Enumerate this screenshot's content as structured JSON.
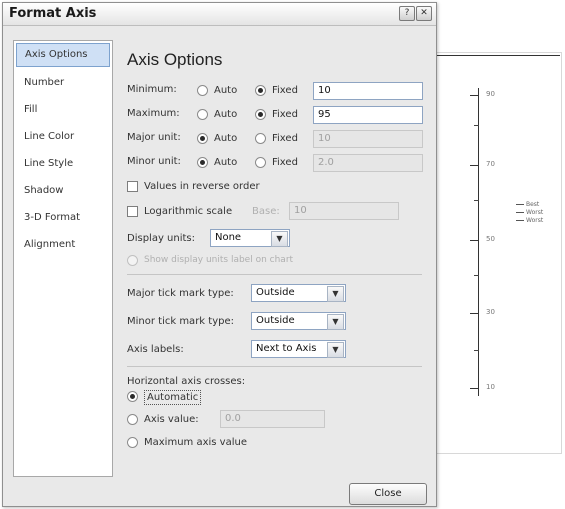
{
  "window": {
    "title": "Format Axis",
    "help_glyph": "?",
    "close_glyph": "✕"
  },
  "nav": {
    "items": [
      "Axis Options",
      "Number",
      "Fill",
      "Line Color",
      "Line Style",
      "Shadow",
      "3-D Format",
      "Alignment"
    ]
  },
  "panel": {
    "heading": "Axis Options",
    "minimum": {
      "label": "Minimum:",
      "auto": "Auto",
      "fixed": "Fixed",
      "value": "10",
      "selected": "fixed"
    },
    "maximum": {
      "label": "Maximum:",
      "auto": "Auto",
      "fixed": "Fixed",
      "value": "95",
      "selected": "fixed"
    },
    "major_unit": {
      "label": "Major unit:",
      "auto": "Auto",
      "fixed": "Fixed",
      "value": "10",
      "selected": "auto"
    },
    "minor_unit": {
      "label": "Minor unit:",
      "auto": "Auto",
      "fixed": "Fixed",
      "value": "2.0",
      "selected": "auto"
    },
    "reverse_order": "Values in reverse order",
    "log_scale": "Logarithmic scale",
    "log_base_label": "Base:",
    "log_base_value": "10",
    "display_units_label": "Display units:",
    "display_units_value": "None",
    "show_units_label": "Show display units label on chart",
    "major_tick_label": "Major tick mark type:",
    "major_tick_value": "Outside",
    "minor_tick_label": "Minor tick mark type:",
    "minor_tick_value": "Outside",
    "axis_labels_label": "Axis labels:",
    "axis_labels_value": "Next to Axis",
    "h_cross_label": "Horizontal axis crosses:",
    "h_cross_auto": "Automatic",
    "h_cross_value_label": "Axis value:",
    "h_cross_value": "0.0",
    "h_cross_max": "Maximum axis value",
    "close_label": "Close"
  },
  "background_chart": {
    "tick_labels": [
      "90",
      "70",
      "50",
      "30",
      "10"
    ],
    "legend": [
      "Best",
      "Worst",
      "Worst"
    ]
  }
}
